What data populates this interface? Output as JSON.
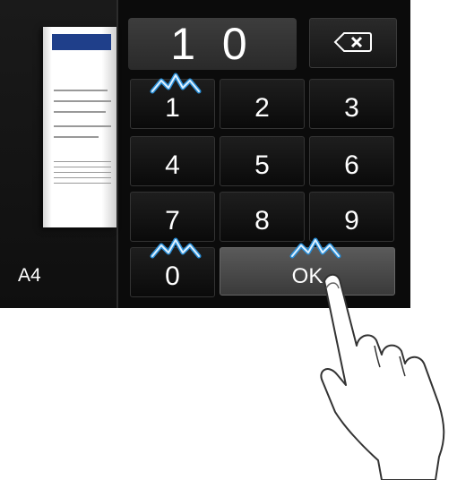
{
  "display": {
    "value": "1 0"
  },
  "paper": {
    "size": "A4"
  },
  "keypad": {
    "keys": [
      "1",
      "2",
      "3",
      "4",
      "5",
      "6",
      "7",
      "8",
      "9",
      "0"
    ],
    "ok_label": "OK"
  },
  "icons": {
    "backspace": "backspace-icon",
    "tap_indicators": [
      "tap-indicator-icon"
    ],
    "hand": "pointing-hand-icon"
  },
  "colors": {
    "screen_bg": "#0b0b0b",
    "display_bg": "#3d3d3d",
    "ok_bg": "#4a4a4a",
    "tap_blue": "#2a8fd8",
    "preview_bar": "#1f3f8a"
  }
}
